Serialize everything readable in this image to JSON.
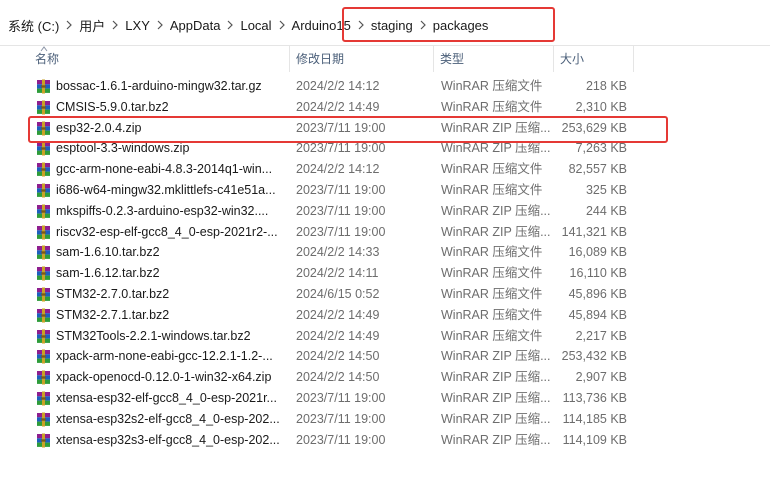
{
  "breadcrumb": [
    "系统 (C:)",
    "用户",
    "LXY",
    "AppData",
    "Local",
    "Arduino15",
    "staging",
    "packages"
  ],
  "columns": {
    "name": "名称",
    "date": "修改日期",
    "type": "类型",
    "size": "大小"
  },
  "files": [
    {
      "name": "bossac-1.6.1-arduino-mingw32.tar.gz",
      "date": "2024/2/2 14:12",
      "type": "WinRAR 压缩文件",
      "size": "218 KB"
    },
    {
      "name": "CMSIS-5.9.0.tar.bz2",
      "date": "2024/2/2 14:49",
      "type": "WinRAR 压缩文件",
      "size": "2,310 KB"
    },
    {
      "name": "esp32-2.0.4.zip",
      "date": "2023/7/11 19:00",
      "type": "WinRAR ZIP 压缩...",
      "size": "253,629 KB"
    },
    {
      "name": "esptool-3.3-windows.zip",
      "date": "2023/7/11 19:00",
      "type": "WinRAR ZIP 压缩...",
      "size": "7,263 KB"
    },
    {
      "name": "gcc-arm-none-eabi-4.8.3-2014q1-win...",
      "date": "2024/2/2 14:12",
      "type": "WinRAR 压缩文件",
      "size": "82,557 KB"
    },
    {
      "name": "i686-w64-mingw32.mklittlefs-c41e51a...",
      "date": "2023/7/11 19:00",
      "type": "WinRAR 压缩文件",
      "size": "325 KB"
    },
    {
      "name": "mkspiffs-0.2.3-arduino-esp32-win32....",
      "date": "2023/7/11 19:00",
      "type": "WinRAR ZIP 压缩...",
      "size": "244 KB"
    },
    {
      "name": "riscv32-esp-elf-gcc8_4_0-esp-2021r2-...",
      "date": "2023/7/11 19:00",
      "type": "WinRAR ZIP 压缩...",
      "size": "141,321 KB"
    },
    {
      "name": "sam-1.6.10.tar.bz2",
      "date": "2024/2/2 14:33",
      "type": "WinRAR 压缩文件",
      "size": "16,089 KB"
    },
    {
      "name": "sam-1.6.12.tar.bz2",
      "date": "2024/2/2 14:11",
      "type": "WinRAR 压缩文件",
      "size": "16,110 KB"
    },
    {
      "name": "STM32-2.7.0.tar.bz2",
      "date": "2024/6/15 0:52",
      "type": "WinRAR 压缩文件",
      "size": "45,896 KB"
    },
    {
      "name": "STM32-2.7.1.tar.bz2",
      "date": "2024/2/2 14:49",
      "type": "WinRAR 压缩文件",
      "size": "45,894 KB"
    },
    {
      "name": "STM32Tools-2.2.1-windows.tar.bz2",
      "date": "2024/2/2 14:49",
      "type": "WinRAR 压缩文件",
      "size": "2,217 KB"
    },
    {
      "name": "xpack-arm-none-eabi-gcc-12.2.1-1.2-...",
      "date": "2024/2/2 14:50",
      "type": "WinRAR ZIP 压缩...",
      "size": "253,432 KB"
    },
    {
      "name": "xpack-openocd-0.12.0-1-win32-x64.zip",
      "date": "2024/2/2 14:50",
      "type": "WinRAR ZIP 压缩...",
      "size": "2,907 KB"
    },
    {
      "name": "xtensa-esp32-elf-gcc8_4_0-esp-2021r...",
      "date": "2023/7/11 19:00",
      "type": "WinRAR ZIP 压缩...",
      "size": "113,736 KB"
    },
    {
      "name": "xtensa-esp32s2-elf-gcc8_4_0-esp-202...",
      "date": "2023/7/11 19:00",
      "type": "WinRAR ZIP 压缩...",
      "size": "114,185 KB"
    },
    {
      "name": "xtensa-esp32s3-elf-gcc8_4_0-esp-202...",
      "date": "2023/7/11 19:00",
      "type": "WinRAR ZIP 压缩...",
      "size": "114,109 KB"
    }
  ],
  "colors": {
    "highlight": "#e53935",
    "header_text": "#4c607a",
    "meta_text": "#6d6d6d"
  },
  "icons": {
    "file": "winrar-archive-icon",
    "separator": "chevron-right-icon",
    "sort": "sort-ascending-icon"
  }
}
